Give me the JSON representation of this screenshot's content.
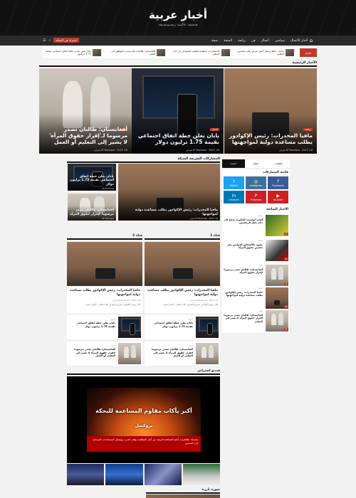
{
  "header": {
    "title": "أخبار عربية",
    "tagline": "صحيفة عالمية ريسبونسيفة"
  },
  "nav": {
    "items": [
      "أخبار الأعمال",
      "سياسي",
      "أعمال",
      "فن",
      "رياضة",
      "الصحة",
      "صحة"
    ],
    "subscribe_label": "اشترك في المجلة"
  },
  "ticker": {
    "label": "عاجل",
    "items": [
      "عاجل: خطة ومثال أخبار تعرض عليه لتحسين التعليم",
      "الانتشارات: منظمة تكشف الصومال من أجل السلام",
      "أفغانستان: طالبات تلم بسبب حقوقهن في العمل",
      "يابان يعلن تحديد خطة اتفاق اجتماعي بقيمة 1.75 تريليون"
    ]
  },
  "hero": {
    "section_title": "الأخبار الرئيسية",
    "items": [
      {
        "title": "مافيا المخدرات: رئيس الإكوادور يطلب مساعدة دولية لمواجهتها",
        "tag": "رياضة",
        "meta": "AF Business · 2023 ,16 فبراير"
      },
      {
        "title": "يابان يعلن خطة اتفاق اجتماعي بقيمة 1.75 ترليون دولار",
        "tag": "أعمال",
        "meta": "AF Business · 2023 ,16 فبراير"
      },
      {
        "title": "أفغانستان: طالبان تصدر مرسوما لـ'إقرار حقوق المرأة' لا يشير إلى التعليم أو العمل",
        "tag": "صحة",
        "meta": "AF Business · 2023 ,16 فبراير"
      }
    ]
  },
  "quick_section": {
    "title": "المشاركات السريعة الشبكة",
    "big_title": "مافيا المخدرات: رئيس الإكوادور يطلب مساعدة دولية لمواجهتها",
    "big_meta": "AF Business · 2023 ,16 فبراير",
    "small": [
      {
        "title": "يابان يعلن خطة اتفاق اجتماعي بقيمة 1.75 ترليون دولار",
        "meta": "AF Business"
      },
      {
        "title": "أفغانستان: طالبان تصدر مرسوما لإقرار حقوق المرأة",
        "meta": "AF Business"
      }
    ]
  },
  "grid_section": {
    "title_right": "قناة 1",
    "title_left": "قناة 2",
    "cards": [
      {
        "title": "مافيا المخدرات: رئيس الإكوادور يطلب مساعدة دولية لمواجهتها",
        "meta": "AF Business · 2023 ,16 فبراير",
        "excerpt": "قال رئيس الإكوادور غييرمو لاسو إن بلاده تطلب... الخبر اتصل..."
      },
      {
        "title": "مافيا المخدرات: رئيس الإكوادور يطلب مساعدة دولية لمواجهتها",
        "meta": "AF Business · 2023 ,16 فبراير",
        "excerpt": "قال رئيس الإكوادور غييرمو لاسو إن بلاده تطلب... الخبر اتصل..."
      }
    ],
    "rows": [
      {
        "cat": "أعمال",
        "title": "يابان يعلن خطة اتفاق اجتماعي بقيمة 1.75 ترليون دولار"
      },
      {
        "cat": "أعمال",
        "title": "يابان يعلن خطة اتفاق اجتماعي بقيمة 1.75 ترليون دولار"
      },
      {
        "cat": "صحة",
        "title": "أفغانستان: طالبان تصدر مرسوما لإقرار حقوق المرأة لا يشير إلى التعليم أو العمل"
      },
      {
        "cat": "صحة",
        "title": "أفغانستان: طالبان تصدر مرسوما لإقرار حقوق المرأة لا يشير إلى التعليم أو العمل"
      }
    ]
  },
  "video": {
    "section_title": "فيديو استراتي",
    "caption": "أكبر يأكاب مقاوم المساعمة للبحكة",
    "sub": "بروكسل",
    "bar_text": "متحدثا: مظاهرات أمام المحكمة الدولية من أجل المطالبة بوقف الحرب وإيصال المساعدات الإنسانية إلى المدنيين"
  },
  "bottom_section": {
    "title": "صورة بارزة"
  },
  "sidebar": {
    "tabs": [
      "حديث",
      "شائع",
      "تعليقات"
    ],
    "social_title": "قائمة المشاركات",
    "social": [
      {
        "name": "Twitter",
        "icon": "twitter-icon",
        "color": "#1da1f2",
        "glyph": "t"
      },
      {
        "name": "Instagram",
        "icon": "instagram-icon",
        "color": "#3f729b",
        "glyph": "◎"
      },
      {
        "name": "Facebook",
        "icon": "facebook-icon",
        "color": "#3b5998",
        "glyph": "f"
      },
      {
        "name": "LinkedIn",
        "icon": "linkedin-icon",
        "color": "#0077b5",
        "glyph": "in"
      },
      {
        "name": "Pinterest",
        "icon": "pinterest-icon",
        "color": "#cb2027",
        "glyph": "P"
      },
      {
        "name": "Youtube",
        "icon": "youtube-icon",
        "color": "#cd201f",
        "glyph": "▶"
      }
    ],
    "popular_title": "الأخبار الشائعة",
    "popular": [
      {
        "num": "1",
        "cat": "رياضة",
        "title": "ألعاب أولمبية: الحكومة تحتاج إلى دعم حفل الرياضيين"
      },
      {
        "num": "2",
        "cat": "رياضة",
        "title": "تعاون بالأشخاص الدوليين نحو تحسين حقوق المرأة"
      },
      {
        "num": "3",
        "cat": "صحة",
        "title": "أفغانستان: طالبان تصدر مرسوما لإقرار حقوق المرأة"
      },
      {
        "num": "4",
        "cat": "أعمال",
        "title": "مافيا المخدرات: رئيس الإكوادور يطلب مساعدة دولية لمواجهتها"
      },
      {
        "num": "5",
        "cat": "أعمال",
        "title": "يابان يعلن خطة اتفاق اجتماعي بقيمة 1.75 ترليون دولار"
      },
      {
        "num": "6",
        "cat": "صحة",
        "title": "أفغانستان: طالبان تصدر مرسوما لإقرار حقوق المرأة لا يشير إلى التعليم"
      }
    ]
  },
  "colors": {
    "accent": "#c0392b",
    "header_bg": "#111111",
    "nav_bg": "#2a2a2a"
  }
}
